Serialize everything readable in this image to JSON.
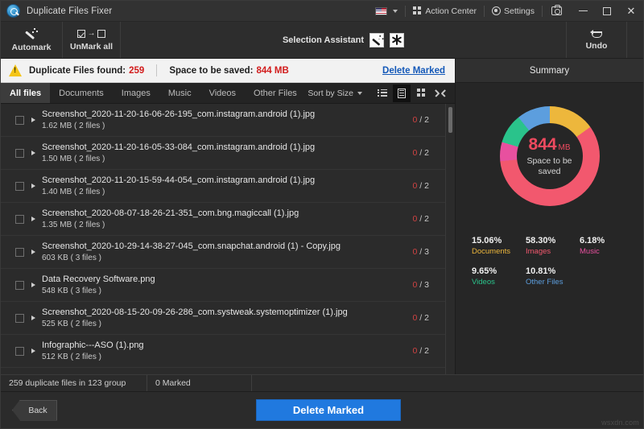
{
  "window": {
    "title": "Duplicate Files Fixer",
    "logo_icon": "magnifier-logo-icon",
    "titlebar": {
      "language_icon": "us-flag-icon",
      "language_caret": "chevron-down-icon",
      "action_center": "Action Center",
      "action_center_icon": "grid-icon",
      "settings": "Settings",
      "settings_icon": "gear-icon",
      "screenshot_icon": "camera-icon",
      "minimize_icon": "minimize-icon",
      "maximize_icon": "maximize-icon",
      "close_icon": "close-icon"
    }
  },
  "toolbar": {
    "automark": "Automark",
    "automark_icon": "magic-wand-icon",
    "unmark_all": "UnMark all",
    "unmark_all_icon": "uncheck-all-icon",
    "selection_assistant": "Selection Assistant",
    "selection_assistant_wand_icon": "magic-wand-icon",
    "selection_assistant_asterisk_icon": "asterisk-icon",
    "undo": "Undo",
    "undo_icon": "undo-arrow-icon"
  },
  "banner": {
    "warning_icon": "warning-triangle-icon",
    "found_label": "Duplicate Files found:",
    "found_value": "259",
    "space_label": "Space to be saved:",
    "space_value": "844 MB",
    "delete_marked_link": "Delete Marked",
    "accent_red": "#d21c1c",
    "link_blue": "#1358b8"
  },
  "tabs": {
    "items": [
      {
        "label": "All files",
        "active": true
      },
      {
        "label": "Documents",
        "active": false
      },
      {
        "label": "Images",
        "active": false
      },
      {
        "label": "Music",
        "active": false
      },
      {
        "label": "Videos",
        "active": false
      },
      {
        "label": "Other Files",
        "active": false
      }
    ],
    "sort_label": "Sort by Size",
    "sort_caret_icon": "caret-down-icon",
    "view_buttons": [
      {
        "icon": "list-view-icon",
        "active": false
      },
      {
        "icon": "detail-view-icon",
        "active": true
      },
      {
        "icon": "grid-view-icon",
        "active": false
      },
      {
        "icon": "expand-view-icon",
        "active": false
      }
    ]
  },
  "file_list": {
    "rows": [
      {
        "name": "Screenshot_2020-11-20-16-06-26-195_com.instagram.android (1).jpg",
        "meta": "1.62 MB  ( 2 files )",
        "marked": "0",
        "total": "2"
      },
      {
        "name": "Screenshot_2020-11-20-16-05-33-084_com.instagram.android (1).jpg",
        "meta": "1.50 MB  ( 2 files )",
        "marked": "0",
        "total": "2"
      },
      {
        "name": "Screenshot_2020-11-20-15-59-44-054_com.instagram.android (1).jpg",
        "meta": "1.40 MB  ( 2 files )",
        "marked": "0",
        "total": "2"
      },
      {
        "name": "Screenshot_2020-08-07-18-26-21-351_com.bng.magiccall (1).jpg",
        "meta": "1.35 MB  ( 2 files )",
        "marked": "0",
        "total": "2"
      },
      {
        "name": "Screenshot_2020-10-29-14-38-27-045_com.snapchat.android (1) - Copy.jpg",
        "meta": "603 KB  ( 3 files )",
        "marked": "0",
        "total": "3"
      },
      {
        "name": "Data Recovery Software.png",
        "meta": "548 KB  ( 3 files )",
        "marked": "0",
        "total": "3"
      },
      {
        "name": "Screenshot_2020-08-15-20-09-26-286_com.systweak.systemoptimizer (1).jpg",
        "meta": "525 KB  ( 2 files )",
        "marked": "0",
        "total": "2"
      },
      {
        "name": "Infographic---ASO (1).png",
        "meta": "512 KB  ( 2 files )",
        "marked": "0",
        "total": "2"
      }
    ],
    "checkbox_icon": "checkbox-unchecked-icon",
    "expand_icon": "triangle-right-icon",
    "scrollbar_icon": "vertical-scrollbar"
  },
  "summary": {
    "title": "Summary",
    "center_value": "844",
    "center_unit": "MB",
    "center_caption": "Space to be saved"
  },
  "chart_data": {
    "type": "pie",
    "title": "Summary",
    "center_label": "844 MB Space to be saved",
    "categories": [
      "Documents",
      "Images",
      "Music",
      "Videos",
      "Other Files"
    ],
    "values": [
      15.06,
      58.3,
      6.18,
      9.65,
      10.81
    ],
    "value_labels": [
      "15.06%",
      "58.30%",
      "6.18%",
      "9.65%",
      "10.81%"
    ],
    "colors": [
      "#edb73c",
      "#f2586e",
      "#e8509f",
      "#2ac38b",
      "#5c9ede"
    ],
    "unit": "%",
    "legend_position": "bottom",
    "donut": true,
    "start_angle": 0
  },
  "status_bar": {
    "duplicates": "259 duplicate files in 123 group",
    "marked": "0 Marked",
    "extra": ""
  },
  "footer": {
    "back": "Back",
    "back_icon": "chevron-left-icon",
    "delete_marked": "Delete Marked",
    "button_blue": "#2079df"
  },
  "watermark": "wsxdn.com"
}
